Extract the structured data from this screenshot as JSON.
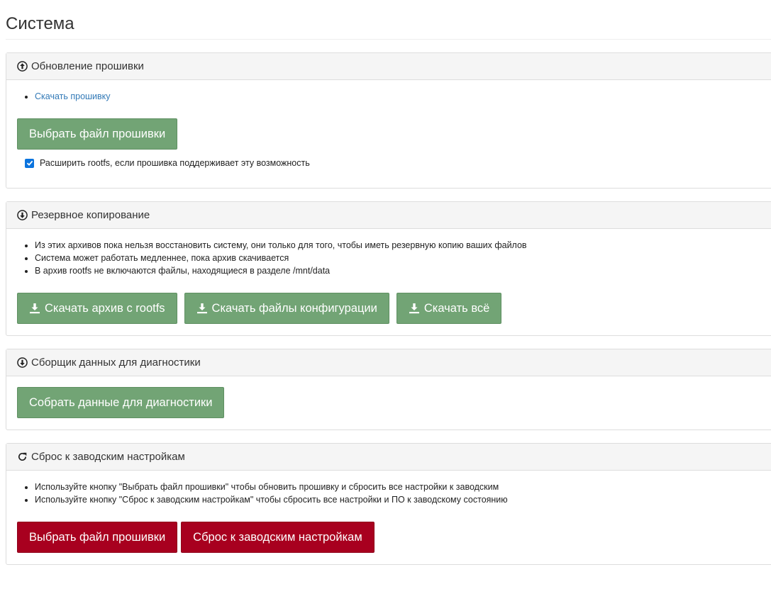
{
  "page": {
    "title": "Система"
  },
  "firmware": {
    "heading": "Обновление прошивки",
    "icon": "circle-arrow-up-icon",
    "download_link": "Скачать прошивку",
    "select_button": "Выбрать файл прошивки",
    "expand_rootfs_label": "Расширить rootfs, если прошивка поддерживает эту возможность",
    "expand_rootfs_checked": true
  },
  "backup": {
    "heading": "Резервное копирование",
    "icon": "circle-arrow-down-icon",
    "notes": [
      "Из этих архивов пока нельзя восстановить систему, они только для того, чтобы иметь резервную копию ваших файлов",
      "Система может работать медленнее, пока архив скачивается",
      "В архив rootfs не включаются файлы, находящиеся в разделе /mnt/data"
    ],
    "buttons": {
      "rootfs": "Скачать архив с rootfs",
      "config": "Скачать файлы конфигурации",
      "all": "Скачать всё"
    }
  },
  "diagnostics": {
    "heading": "Сборщик данных для диагностики",
    "icon": "circle-arrow-down-icon",
    "collect_button": "Собрать данные для диагностики"
  },
  "factory_reset": {
    "heading": "Сброс к заводским настройкам",
    "icon": "refresh-icon",
    "notes": [
      "Используйте кнопку \"Выбрать файл прошивки\" чтобы обновить прошивку и сбросить все настройки к заводским",
      "Используйте кнопку \"Сброс к заводским настройкам\" чтобы сбросить все настройки и ПО к заводскому состоянию"
    ],
    "select_button": "Выбрать файл прошивки",
    "reset_button": "Сброс к заводским настройкам"
  },
  "colors": {
    "green_button": "#72a475",
    "red_button": "#a8001f",
    "link": "#337ab7",
    "checkbox": "#0b74de"
  }
}
